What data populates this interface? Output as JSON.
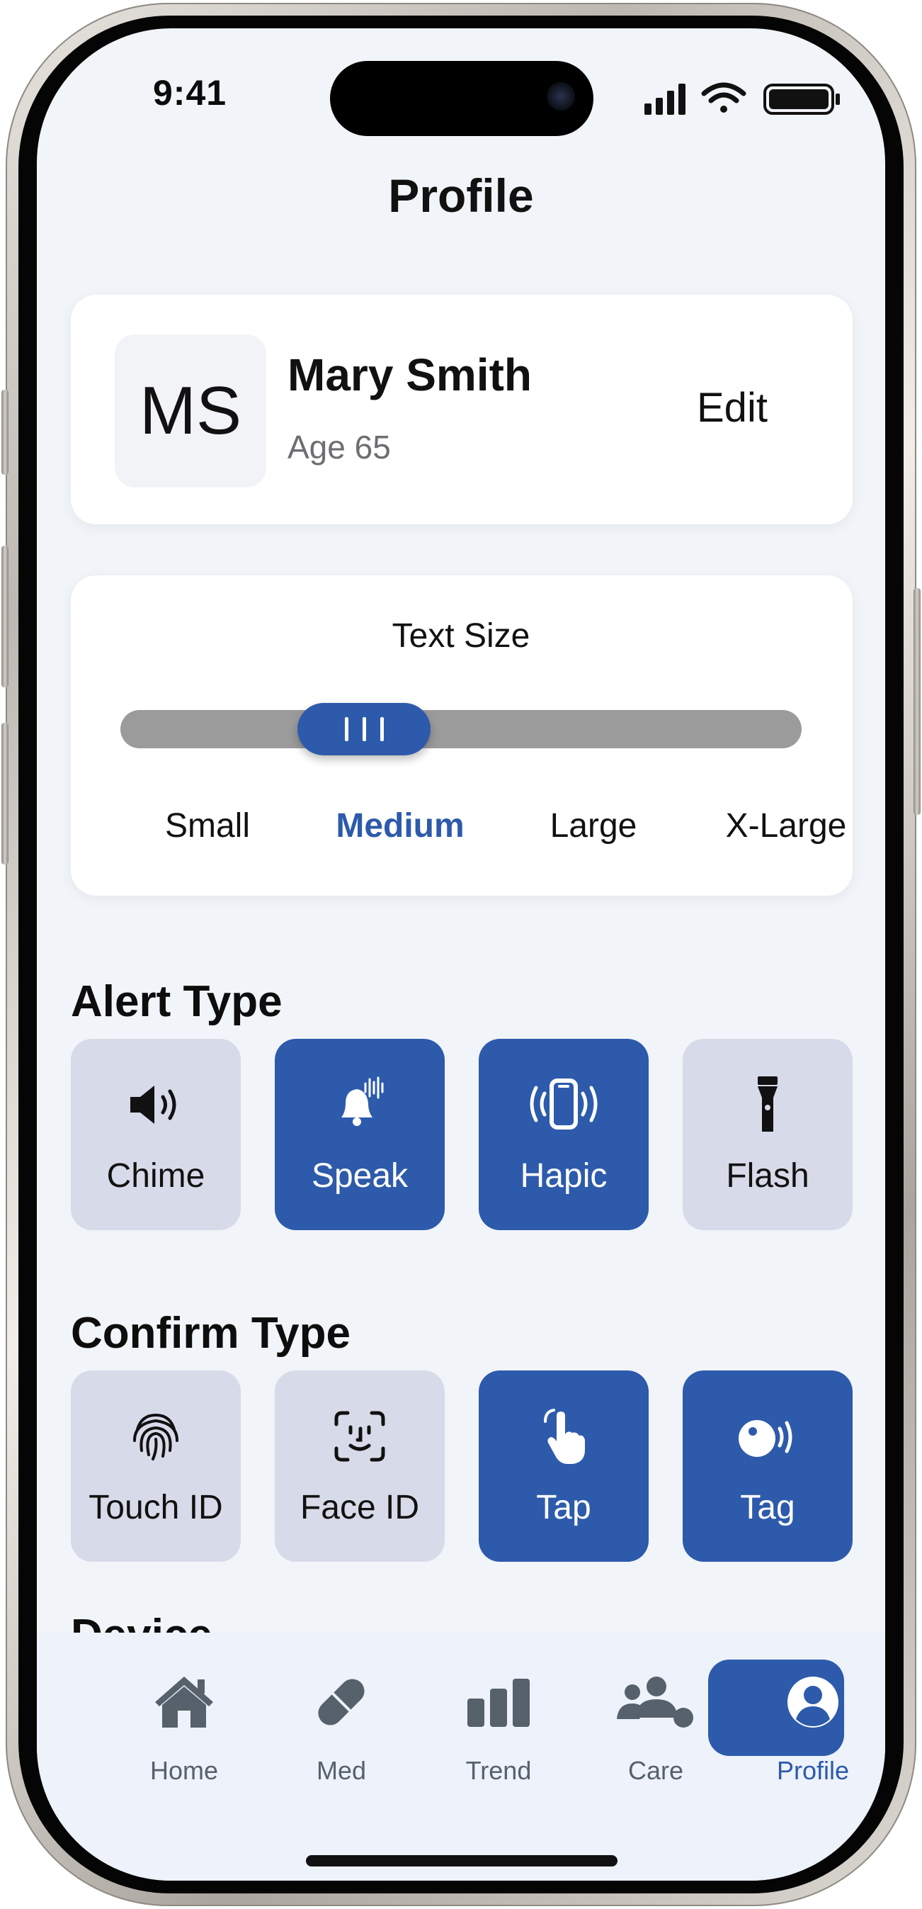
{
  "status_bar": {
    "time": "9:41"
  },
  "header": {
    "title": "Profile"
  },
  "profile": {
    "initials": "MS",
    "name": "Mary Smith",
    "age": "Age 65",
    "edit_label": "Edit"
  },
  "text_size": {
    "title": "Text Size",
    "options": [
      "Small",
      "Medium",
      "Large",
      "X-Large"
    ],
    "selected": "Medium",
    "selected_index": 1
  },
  "alert_type": {
    "title": "Alert Type",
    "options": [
      {
        "label": "Chime",
        "icon": "speaker-icon",
        "selected": false
      },
      {
        "label": "Speak",
        "icon": "bell-voice-icon",
        "selected": true
      },
      {
        "label": "Hapic",
        "icon": "phone-vibrate-icon",
        "selected": true
      },
      {
        "label": "Flash",
        "icon": "flashlight-icon",
        "selected": false
      }
    ]
  },
  "confirm_type": {
    "title": "Confirm Type",
    "options": [
      {
        "label": "Touch ID",
        "icon": "fingerprint-icon",
        "selected": false
      },
      {
        "label": "Face ID",
        "icon": "face-id-icon",
        "selected": false
      },
      {
        "label": "Tap",
        "icon": "hand-tap-icon",
        "selected": true
      },
      {
        "label": "Tag",
        "icon": "nfc-tag-icon",
        "selected": true
      }
    ]
  },
  "device_section": {
    "title": "Device"
  },
  "tabbar": {
    "items": [
      {
        "label": "Home",
        "icon": "house-icon"
      },
      {
        "label": "Med",
        "icon": "pill-icon"
      },
      {
        "label": "Trend",
        "icon": "bar-chart-icon"
      },
      {
        "label": "Care",
        "icon": "people-icon"
      },
      {
        "label": "Profile",
        "icon": "user-circle-icon"
      }
    ],
    "active": "Profile"
  },
  "colors": {
    "accent": "#2d5aab",
    "screen_bg": "#f1f4f8",
    "tile_off": "#d7dae8",
    "tabbar_bg": "#edf2fb",
    "tab_icon": "#56616b",
    "slider_track": "#9b9b9b"
  }
}
